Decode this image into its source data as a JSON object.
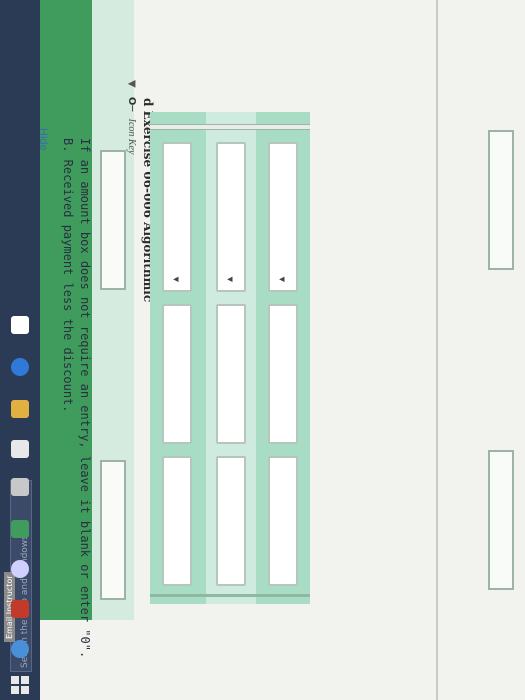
{
  "hide_link": "Hide",
  "instruction_line1": "B. Received payment less the discount.",
  "instruction_line2": "If an amount box does not require an entry, leave it blank or enter \"0\".",
  "key": {
    "chevron": "▼",
    "icon": "O─",
    "label": "Icon Key"
  },
  "exercise_title": "d Exercise 06-006 Algorithmic",
  "table_rows": [
    {
      "dropdown_value": "",
      "debit": "",
      "credit": ""
    },
    {
      "dropdown_value": "",
      "debit": "",
      "credit": ""
    },
    {
      "dropdown_value": "",
      "debit": "",
      "credit": ""
    }
  ],
  "taskbar": {
    "search_placeholder": "Search the web and Windows",
    "email_label": "Email Instructor"
  },
  "colors": {
    "accent_green": "#3f9c5c",
    "row_green": "#a8dcc5",
    "row_light": "#cfeadf",
    "taskbar": "#2b3a55"
  }
}
